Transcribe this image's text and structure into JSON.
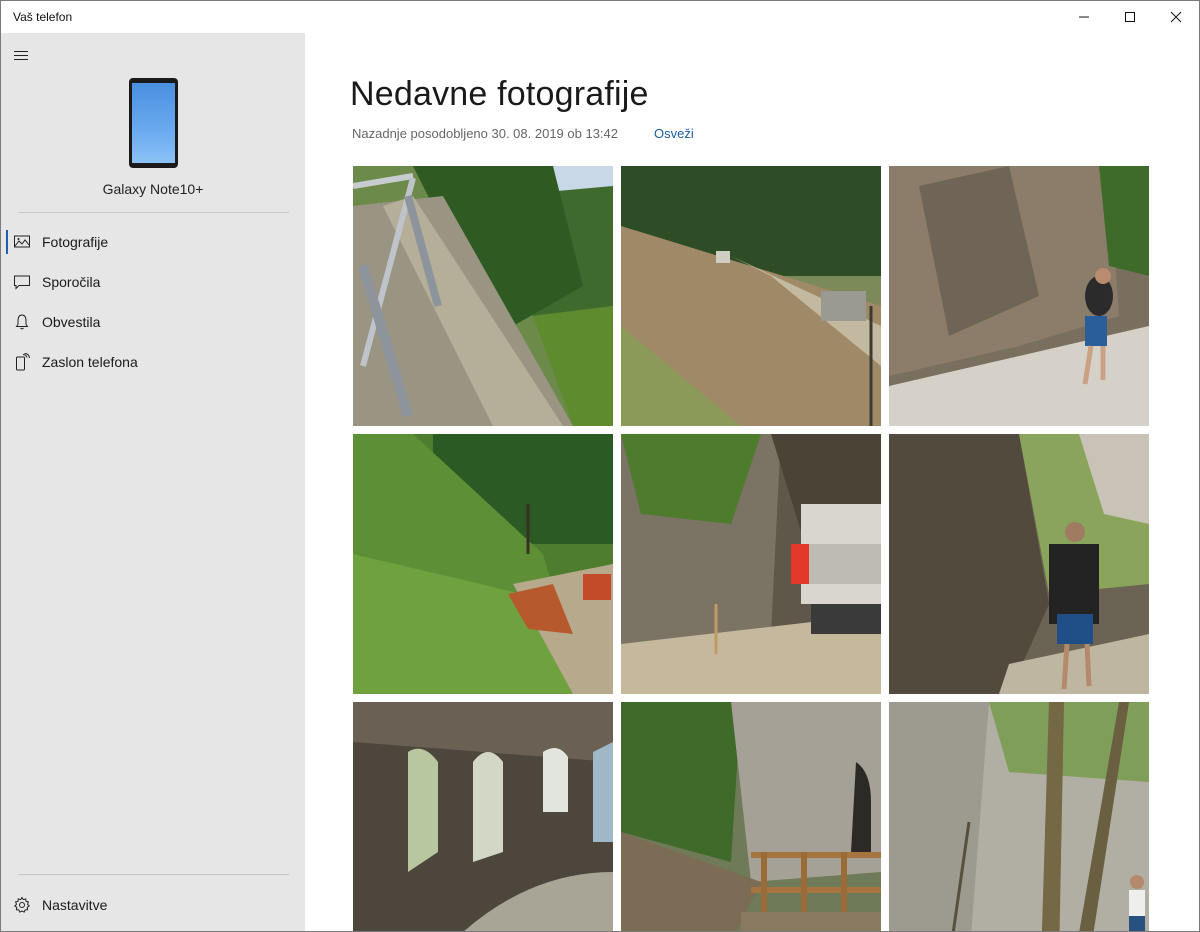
{
  "window": {
    "title": "Vaš telefon"
  },
  "sidebar": {
    "device_name": "Galaxy Note10+",
    "items": [
      {
        "label": "Fotografije",
        "icon": "photos-icon",
        "active": true
      },
      {
        "label": "Sporočila",
        "icon": "message-icon",
        "active": false
      },
      {
        "label": "Obvestila",
        "icon": "bell-icon",
        "active": false
      },
      {
        "label": "Zaslon telefona",
        "icon": "phone-screen-icon",
        "active": false
      }
    ],
    "settings_label": "Nastavitve"
  },
  "main": {
    "title": "Nedavne fotografije",
    "updated_text": "Nazadnje posodobljeno 30. 08. 2019 ob 13:42",
    "refresh_label": "Osveži"
  },
  "colors": {
    "accent": "#1f5fae",
    "sidebar_bg": "#e6e6e6",
    "link": "#1a5ea8"
  },
  "photos": [
    {
      "name": "photo-1"
    },
    {
      "name": "photo-2"
    },
    {
      "name": "photo-3"
    },
    {
      "name": "photo-4"
    },
    {
      "name": "photo-5"
    },
    {
      "name": "photo-6"
    },
    {
      "name": "photo-7"
    },
    {
      "name": "photo-8"
    },
    {
      "name": "photo-9"
    }
  ]
}
